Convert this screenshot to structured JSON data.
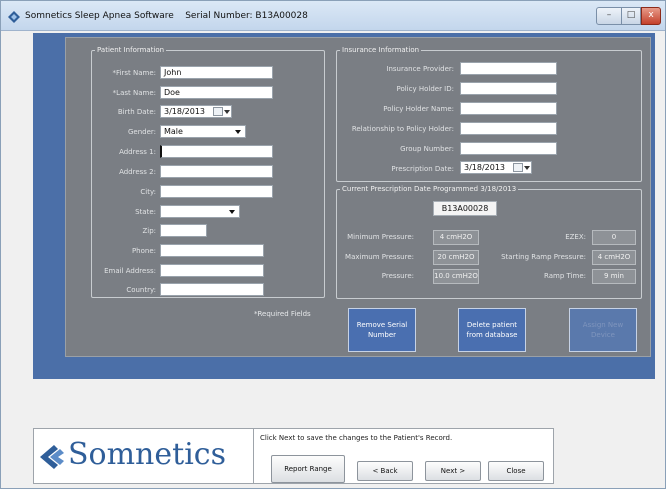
{
  "window": {
    "title": "Somnetics Sleep Apnea Software    Serial Number: B13A00028",
    "controls": {
      "minimize": "–",
      "maximize": "□",
      "close": "x"
    }
  },
  "patient": {
    "legend": "Patient Information",
    "labels": {
      "first_name": "*First Name:",
      "last_name": "*Last Name:",
      "birth_date": "Birth Date:",
      "gender": "Gender:",
      "address1": "Address 1:",
      "address2": "Address 2:",
      "city": "City:",
      "state": "State:",
      "zip": "Zip:",
      "phone": "Phone:",
      "email": "Email Address:",
      "country": "Country:"
    },
    "values": {
      "first_name": "John",
      "last_name": "Doe",
      "birth_date": "3/18/2013",
      "gender": "Male",
      "address1": "",
      "address2": "",
      "city": "",
      "state": "",
      "zip": "",
      "phone": "",
      "email": "",
      "country": ""
    },
    "required_note": "*Required Fields"
  },
  "insurance": {
    "legend": "Insurance Information",
    "labels": {
      "provider": "Insurance Provider:",
      "policy_holder_id": "Policy Holder ID:",
      "policy_holder_name": "Policy Holder Name:",
      "relationship": "Relationship to Policy Holder:",
      "group_number": "Group Number:",
      "prescription_date": "Prescription Date:"
    },
    "values": {
      "provider": "",
      "policy_holder_id": "",
      "policy_holder_name": "",
      "relationship": "",
      "group_number": "",
      "prescription_date": "3/18/2013"
    }
  },
  "prescription": {
    "legend": "Current Prescription     Date Programmed 3/18/2013",
    "serial": "B13A00028",
    "labels": {
      "min_pressure": "Minimum Pressure:",
      "max_pressure": "Maximum Pressure:",
      "pressure": "Pressure:",
      "ezex": "EZEX:",
      "ramp_pressure": "Starting Ramp Pressure:",
      "ramp_time": "Ramp Time:"
    },
    "values": {
      "min_pressure": "4 cmH2O",
      "max_pressure": "20 cmH2O",
      "pressure": "10.0 cmH2O",
      "ezex": "0",
      "ramp_pressure": "4 cmH2O",
      "ramp_time": "9 min"
    }
  },
  "actions": {
    "remove_serial": "Remove Serial\nNumber",
    "delete_patient": "Delete patient\nfrom database",
    "assign_device": "Assign New\nDevice"
  },
  "footer": {
    "logo": "Somnetics",
    "hint": "Click Next to save the changes to the Patient's Record.",
    "report_range": "Report Range",
    "back": "< Back",
    "next": "Next >",
    "close": "Close"
  },
  "colors": {
    "frame_blue": "#4b6fa8",
    "panel_gray": "#7a7e84",
    "logo_blue": "#2f5e99"
  }
}
